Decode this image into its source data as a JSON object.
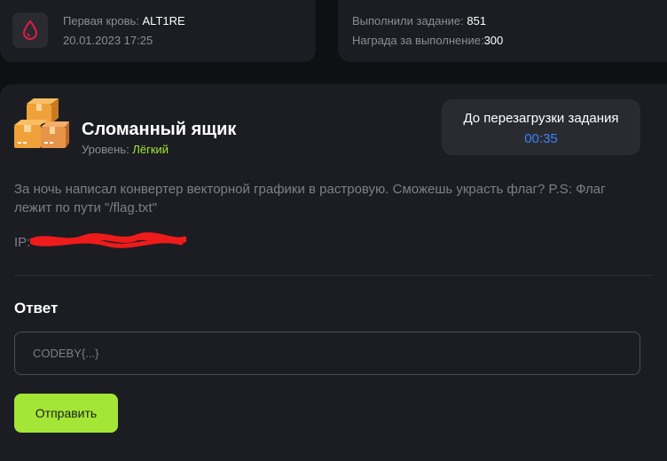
{
  "first_blood": {
    "label": "Первая кровь:",
    "user": "ALT1RE",
    "date": "20.01.2023 17:25",
    "icon": "blood-drop-icon",
    "accent": "#e11d48"
  },
  "stats": {
    "solved_label": "Выполнили задание:",
    "solved_value": "851",
    "reward_label": "Награда за выполнение:",
    "reward_value": "300"
  },
  "task": {
    "icon": "boxes-icon",
    "title": "Сломанный ящик",
    "level_label": "Уровень:",
    "level_value": "Лёгкий",
    "level_color": "#a3e635",
    "description": "За ночь написал конвертер векторной графики в растровую. Сможешь украсть флаг? P.S: Флаг лежит по пути \"/flag.txt\"",
    "ip_label": "IP:"
  },
  "timer": {
    "label": "До перезагрузки задания",
    "value": "00:35",
    "color": "#3b82f6"
  },
  "answer": {
    "title": "Ответ",
    "placeholder": "CODEBY{...}",
    "value": "",
    "submit_label": "Отправить",
    "submit_color": "#a3e635"
  }
}
